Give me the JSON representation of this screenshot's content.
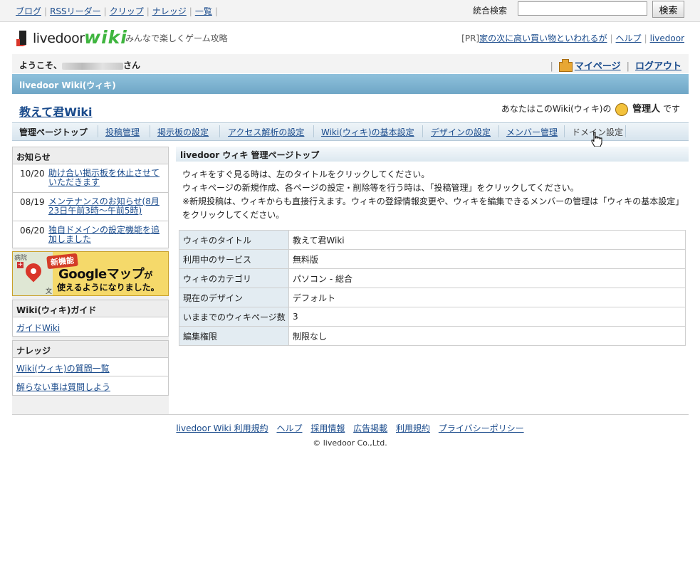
{
  "topnav": {
    "links": [
      "ブログ",
      "RSSリーダー",
      "クリップ",
      "ナレッジ",
      "一覧"
    ],
    "search_label": "統合検索",
    "search_value": "",
    "search_button": "検索"
  },
  "brand": {
    "logo_word1": "livedoor",
    "logo_word2": "wiki",
    "tagline": "みんなで楽しくゲーム攻略",
    "pr_label": "[PR]",
    "pr_link": "家の次に高い買い物といわれるが",
    "help": "ヘルプ",
    "livedoor": "livedoor"
  },
  "welcome": {
    "prefix": "ようこそ、",
    "suffix": "さん",
    "mypage": "マイページ",
    "logout": "ログアウト"
  },
  "bluebar": {
    "title": "livedoor Wiki(ウィキ)"
  },
  "site": {
    "title": "教えて君Wiki",
    "role_prefix": "あなたはこのWiki(ウィキ)の",
    "role": "管理人",
    "role_suffix": "です"
  },
  "adminnav": [
    "管理ページトップ",
    "投稿管理",
    "掲示板の設定",
    "アクセス解析の設定",
    "Wiki(ウィキ)の基本設定",
    "デザインの設定",
    "メンバー管理",
    "ドメイン設定"
  ],
  "news": {
    "heading": "お知らせ",
    "items": [
      {
        "date": "10/20",
        "text": "助け合い掲示板を休止させていただきます"
      },
      {
        "date": "08/19",
        "text": "メンテナンスのお知らせ(8月23日午前3時〜午前5時)"
      },
      {
        "date": "06/20",
        "text": "独自ドメインの設定機能を追加しました"
      }
    ]
  },
  "banner": {
    "small": "病院",
    "badge": "新機能",
    "title": "Googleマップ",
    "title_suffix": "が",
    "subtitle": "使えるようになりました。",
    "map_char": "文"
  },
  "guide": {
    "heading": "Wiki(ウィキ)ガイド",
    "links": [
      "ガイドWiki"
    ]
  },
  "knowledge": {
    "heading": "ナレッジ",
    "links": [
      "Wiki(ウィキ)の質問一覧",
      "解らない事は質問しよう"
    ]
  },
  "main": {
    "heading": "livedoor ウィキ 管理ページトップ",
    "intro": [
      "ウィキをすぐ見る時は、左のタイトルをクリックしてください。",
      "ウィキページの新規作成、各ページの設定・削除等を行う時は、「投稿管理」をクリックしてください。",
      "※新規投稿は、ウィキからも直接行えます。ウィキの登録情報変更や、ウィキを編集できるメンバーの管理は「ウィキの基本設定」",
      "をクリックしてください。"
    ],
    "table": [
      {
        "key": "ウィキのタイトル",
        "value": "教えて君Wiki"
      },
      {
        "key": "利用中のサービス",
        "value": "無料版"
      },
      {
        "key": "ウィキのカテゴリ",
        "value": "パソコン - 総合"
      },
      {
        "key": "現在のデザイン",
        "value": "デフォルト"
      },
      {
        "key": "いままでのウィキページ数",
        "value": "3"
      },
      {
        "key": "編集権限",
        "value": "制限なし"
      }
    ]
  },
  "footer": {
    "links": [
      "livedoor Wiki 利用規約",
      "ヘルプ",
      "採用情報",
      "広告掲載",
      "利用規約",
      "プライバシーポリシー"
    ],
    "copyright": "© livedoor Co.,Ltd."
  },
  "colors": {
    "accent_blue": "#6ea6c6",
    "link": "#1a4b8c",
    "wiki_green": "#3fb53f"
  }
}
